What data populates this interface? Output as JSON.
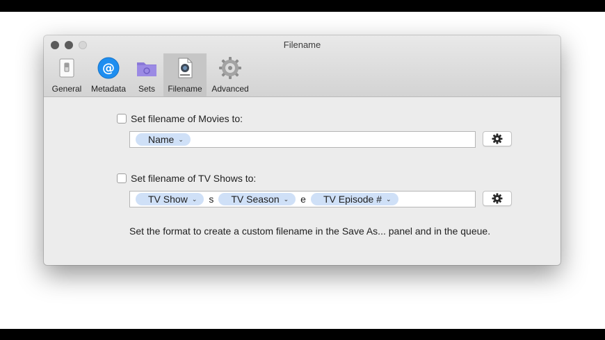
{
  "window": {
    "title": "Filename"
  },
  "toolbar": {
    "tabs": [
      {
        "label": "General",
        "icon": "switch-icon"
      },
      {
        "label": "Metadata",
        "icon": "at-sign-icon"
      },
      {
        "label": "Sets",
        "icon": "folder-icon"
      },
      {
        "label": "Filename",
        "icon": "document-icon",
        "selected": true
      },
      {
        "label": "Advanced",
        "icon": "gear-icon"
      }
    ]
  },
  "movies": {
    "checkbox_label": "Set filename of Movies to:",
    "checked": false,
    "tokens": [
      {
        "label": "Name"
      }
    ]
  },
  "tv": {
    "checkbox_label": "Set filename of TV Shows to:",
    "checked": false,
    "tokens": [
      {
        "label": "TV Show"
      },
      {
        "separator": "s"
      },
      {
        "label": "TV Season"
      },
      {
        "separator": "e"
      },
      {
        "label": "TV Episode #"
      }
    ]
  },
  "help_text": "Set the format to create a custom filename in the Save As... panel and in the queue.",
  "colors": {
    "token_bg": "#cfe0f7",
    "metadata_icon": "#1e8ef0",
    "sets_icon": "#8a78d8",
    "selected_tab": "#c6c6c6"
  }
}
